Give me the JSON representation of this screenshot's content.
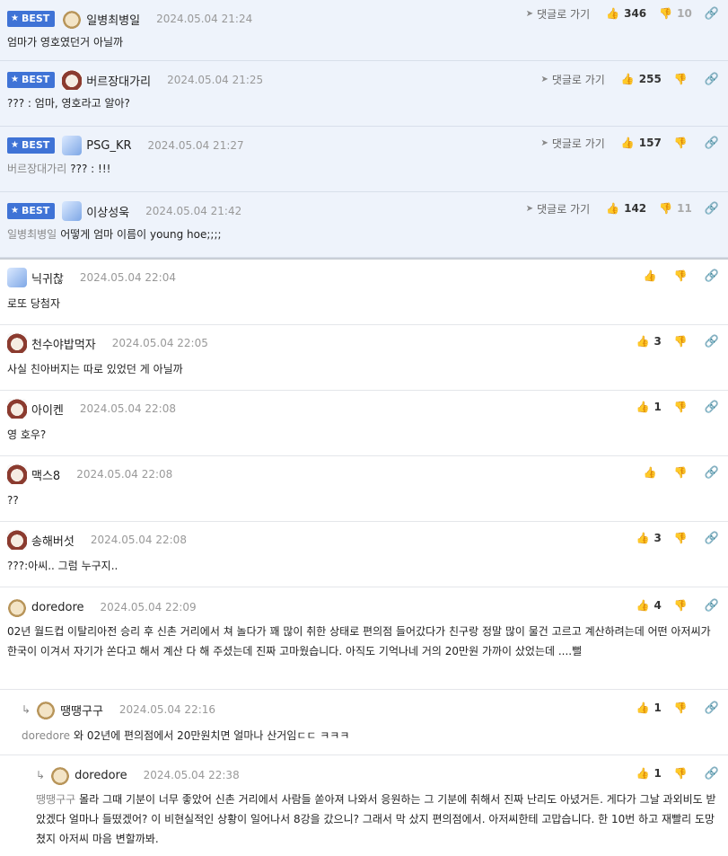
{
  "labels": {
    "best": "BEST",
    "reply_link": "댓글로 가기"
  },
  "best_comments": [
    {
      "nick": "일병최병일",
      "date": "2024.05.04 21:24",
      "likes": "346",
      "dislikes": "10",
      "mention": "",
      "text": "엄마가 영호였던거 아닐까",
      "avatar": "dog"
    },
    {
      "nick": "버르장대가리",
      "date": "2024.05.04 21:25",
      "likes": "255",
      "dislikes": "",
      "mention": "",
      "text": "??? : 엄마, 영호라고 알아?",
      "avatar": "red"
    },
    {
      "nick": "PSG_KR",
      "date": "2024.05.04 21:27",
      "likes": "157",
      "dislikes": "",
      "mention": "버르장대가리",
      "text": "??? : !!!",
      "avatar": "blue"
    },
    {
      "nick": "이상성욱",
      "date": "2024.05.04 21:42",
      "likes": "142",
      "dislikes": "11",
      "mention": "일병최병일",
      "text": "어떻게 엄마 이름이 young hoe;;;;",
      "avatar": "blue"
    }
  ],
  "comments": [
    {
      "nick": "닉귀찮",
      "date": "2024.05.04 22:04",
      "likes": "",
      "text": "로또 당첨자",
      "avatar": "blue"
    },
    {
      "nick": "천수야밥먹자",
      "date": "2024.05.04 22:05",
      "likes": "3",
      "text": "사실 친아버지는 따로 있었던 게 아닐까",
      "avatar": "red"
    },
    {
      "nick": "아이켄",
      "date": "2024.05.04 22:08",
      "likes": "1",
      "text": "영 호우?",
      "avatar": "red"
    },
    {
      "nick": "맥스8",
      "date": "2024.05.04 22:08",
      "likes": "",
      "text": "??",
      "avatar": "red"
    },
    {
      "nick": "송해버섯",
      "date": "2024.05.04 22:08",
      "likes": "3",
      "text": "???:아씨.. 그럼 누구지..",
      "avatar": "red"
    },
    {
      "nick": "doredore",
      "date": "2024.05.04 22:09",
      "likes": "4",
      "text": "02년 월드컵 이탈리아전 승리 후 신촌 거리에서 쳐 놀다가 꽤 많이 취한 상태로 편의점 들어갔다가 친구랑 정말 많이 물건 고르고 계산하려는데 어떤 아저씨가 한국이 이겨서 자기가 쏜다고 해서 계산 다 해 주셨는데 진짜 고마웠습니다. 아직도 기억나네 거의 20만원 가까이 샀었는데 ....뻘",
      "avatar": "dog"
    }
  ],
  "replies": [
    {
      "nick": "땡땡구구",
      "date": "2024.05.04 22:16",
      "likes": "1",
      "mention": "doredore",
      "text": "와 02년에 편의점에서 20만원치면 얼마나 산거임ㄷㄷ ㅋㅋㅋ",
      "avatar": "dog"
    },
    {
      "nick": "doredore",
      "date": "2024.05.04 22:38",
      "likes": "1",
      "mention": "땡땡구구",
      "text": "몰라 그때 기분이 너무 좋았어 신촌 거리에서 사람들 쏟아져 나와서 응원하는 그 기분에 취해서 진짜 난리도 아녔거든. 게다가 그날 과외비도 받았겠다 얼마나 들떴겠어? 이 비현실적인 상황이 일어나서 8강을 갔으니? 그래서 막 샀지 편의점에서. 아저씨한테 고맙습니다. 한 10번 하고 재빨리 도망쳤지 아저씨 마음 변할까봐.",
      "avatar": "dog"
    }
  ],
  "icons": {
    "like": "thumbs-up-icon",
    "dislike": "thumbs-down-icon",
    "link": "link-icon",
    "star": "star-icon",
    "arrow": "send-arrow-icon",
    "reply": "reply-arrow-icon"
  },
  "colors": {
    "best_bg": "#eef3fb",
    "badge": "#3f73d6"
  }
}
